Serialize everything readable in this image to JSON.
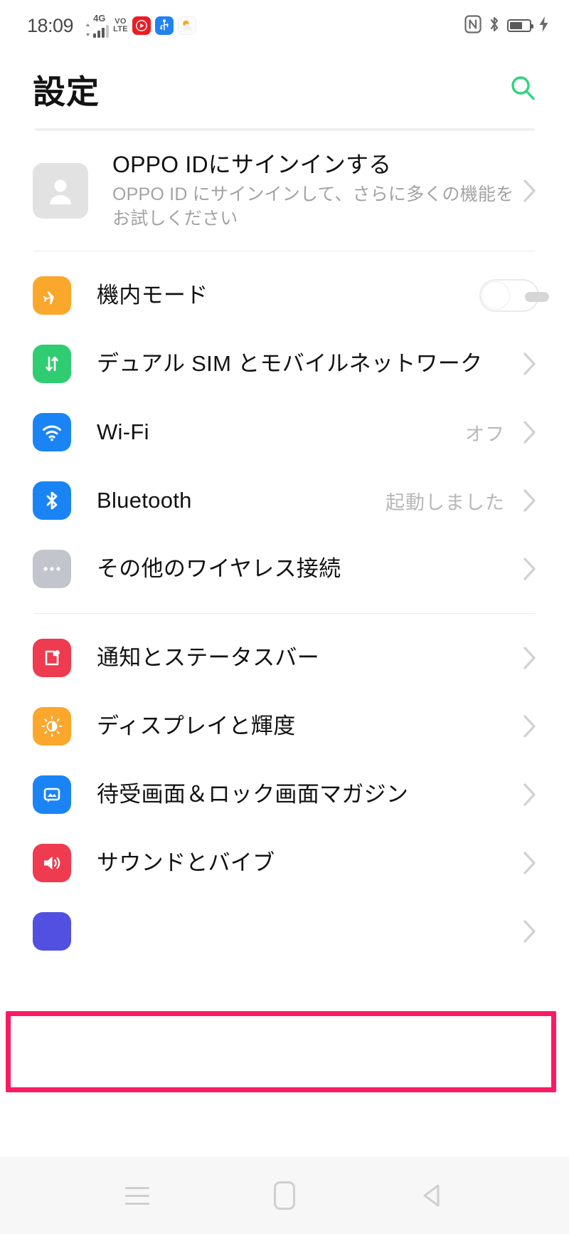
{
  "status_bar": {
    "time": "18:09",
    "network_tag": "4G",
    "volte_line1": "VO",
    "volte_line2": "LTE",
    "icons_left": [
      "signal-updown-icon",
      "signal-bars-icon",
      "volte-icon",
      "youtube-music-icon",
      "usb-icon",
      "weather-icon"
    ],
    "icons_right": [
      "nfc-icon",
      "bluetooth-icon",
      "battery-icon",
      "charging-bolt-icon"
    ],
    "battery_level": "65",
    "nfc_label": "N"
  },
  "header": {
    "title": "設定",
    "search_icon": "search-icon",
    "search_color": "#2ed47e"
  },
  "account": {
    "title": "OPPO IDにサインインする",
    "subtitle": "OPPO ID にサインインして、さらに多くの機能をお試しください",
    "avatar_icon": "person-icon",
    "chevron": "chevron-right-icon"
  },
  "groups": [
    {
      "name": "connectivity",
      "items": [
        {
          "label": "機内モード",
          "icon": "airplane-icon",
          "icon_color": "#fba72c",
          "control": "toggle",
          "toggle_on": false,
          "value": ""
        },
        {
          "label": "デュアル SIM とモバイルネットワーク",
          "icon": "sim-data-icon",
          "icon_color": "#2fcc71",
          "control": "chevron",
          "value": ""
        },
        {
          "label": "Wi-Fi",
          "icon": "wifi-icon",
          "icon_color": "#1a84f5",
          "control": "chevron",
          "value": "オフ"
        },
        {
          "label": "Bluetooth",
          "icon": "bluetooth-icon",
          "icon_color": "#1a84f5",
          "control": "chevron",
          "value": "起動しました"
        },
        {
          "label": "その他のワイヤレス接続",
          "icon": "more-dots-icon",
          "icon_color": "#c2c6cc",
          "control": "chevron",
          "value": ""
        }
      ]
    },
    {
      "name": "device",
      "items": [
        {
          "label": "通知とステータスバー",
          "icon": "notification-icon",
          "icon_color": "#ee3b4f",
          "control": "chevron",
          "value": ""
        },
        {
          "label": "ディスプレイと輝度",
          "icon": "brightness-icon",
          "icon_color": "#fba72c",
          "control": "chevron",
          "value": "",
          "highlighted": true
        },
        {
          "label": "待受画面＆ロック画面マガジン",
          "icon": "wallpaper-icon",
          "icon_color": "#1a84f5",
          "control": "chevron",
          "value": ""
        },
        {
          "label": "サウンドとバイブ",
          "icon": "sound-icon",
          "icon_color": "#ee3b4f",
          "control": "chevron",
          "value": ""
        }
      ]
    }
  ],
  "highlight": {
    "color": "#fb1a63",
    "target_label": "ディスプレイと輝度"
  },
  "nav_bar": {
    "recents_icon": "recents-menu-icon",
    "home_icon": "home-icon",
    "back_icon": "back-triangle-icon"
  }
}
